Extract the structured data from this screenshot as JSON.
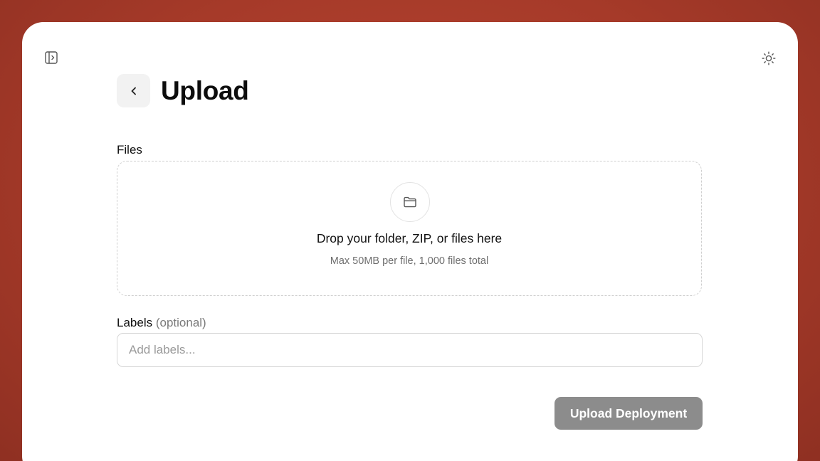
{
  "toolbar": {
    "sidebar_toggle_icon": "sidebar-toggle-icon",
    "theme_toggle_icon": "sun-icon"
  },
  "header": {
    "back_icon": "chevron-left-icon",
    "title": "Upload"
  },
  "files": {
    "label": "Files",
    "dropzone": {
      "icon": "folder-icon",
      "title": "Drop your folder, ZIP, or files here",
      "subtitle": "Max 50MB per file, 1,000 files total"
    }
  },
  "labels": {
    "label": "Labels",
    "optional_hint": "(optional)",
    "input_value": "",
    "placeholder": "Add labels..."
  },
  "actions": {
    "upload_label": "Upload Deployment",
    "upload_disabled": true
  },
  "colors": {
    "background": "#a63a29",
    "surface": "#ffffff",
    "button_disabled": "#8c8c8c",
    "muted_text": "#6e6e6e"
  }
}
